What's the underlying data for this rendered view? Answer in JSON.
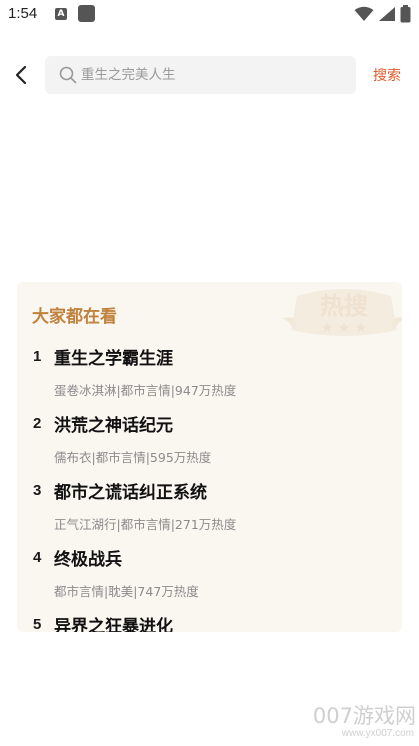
{
  "status_bar": {
    "time": "1:54",
    "app_icon_letter": "A"
  },
  "search": {
    "placeholder": "重生之完美人生",
    "value": "",
    "button_label": "搜索"
  },
  "hot_section": {
    "title": "大家都在看",
    "watermark_text": "热搜",
    "items": [
      {
        "rank": "1",
        "name": "重生之学霸生涯",
        "meta": "蛋卷冰淇淋|都市言情|947万热度"
      },
      {
        "rank": "2",
        "name": "洪荒之神话纪元",
        "meta": "儒布衣|都市言情|595万热度"
      },
      {
        "rank": "3",
        "name": "都市之谎话纠正系统",
        "meta": "正气江湖行|都市言情|271万热度"
      },
      {
        "rank": "4",
        "name": "终极战兵",
        "meta": "都市言情|耽美|747万热度"
      },
      {
        "rank": "5",
        "name": "异界之狂暴进化",
        "meta": ""
      }
    ]
  },
  "site_watermark": {
    "main": "007游戏网",
    "url": "www.yx007.com"
  },
  "colors": {
    "accent": "#e25a2a",
    "hot_title": "#c0823d",
    "card_bg": "#faf6f0",
    "search_bg": "#f3f3f3"
  }
}
